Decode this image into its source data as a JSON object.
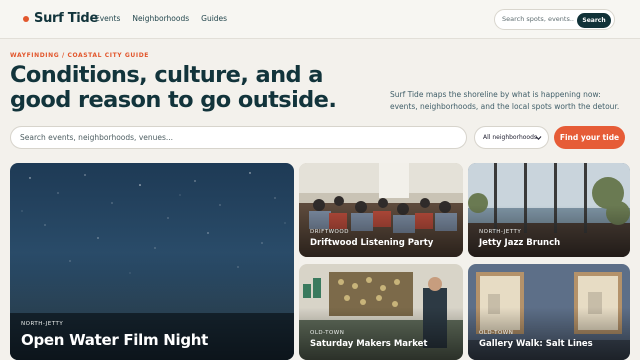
{
  "header": {
    "brand": "Surf Tide",
    "nav": [
      "Events",
      "Neighborhoods",
      "Guides"
    ],
    "search_placeholder": "Search spots, events...",
    "search_button": "Search"
  },
  "hero": {
    "eyebrow": "WAYFINDING / COASTAL CITY GUIDE",
    "headline": "Conditions, culture, and a good reason to go outside.",
    "lede": "Surf Tide maps the shoreline by what is happening now: events, neighborhoods, and the local spots worth the detour."
  },
  "search": {
    "placeholder": "Search events, neighborhoods, venues...",
    "neighborhood_select": "All neighborhoods",
    "cta": "Find your tide"
  },
  "cards": [
    {
      "tag": "NORTH-JETTY",
      "title": "Open Water Film Night"
    },
    {
      "tag": "DRIFTWOOD",
      "title": "Driftwood Listening Party"
    },
    {
      "tag": "NORTH-JETTY",
      "title": "Jetty Jazz Brunch"
    },
    {
      "tag": "OLD-TOWN",
      "title": "Saturday Makers Market"
    },
    {
      "tag": "OLD-TOWN",
      "title": "Gallery Walk: Salt Lines"
    }
  ],
  "colors": {
    "accent": "#e2572d",
    "brand_dark": "#12343b",
    "background": "#f3f1ec"
  }
}
